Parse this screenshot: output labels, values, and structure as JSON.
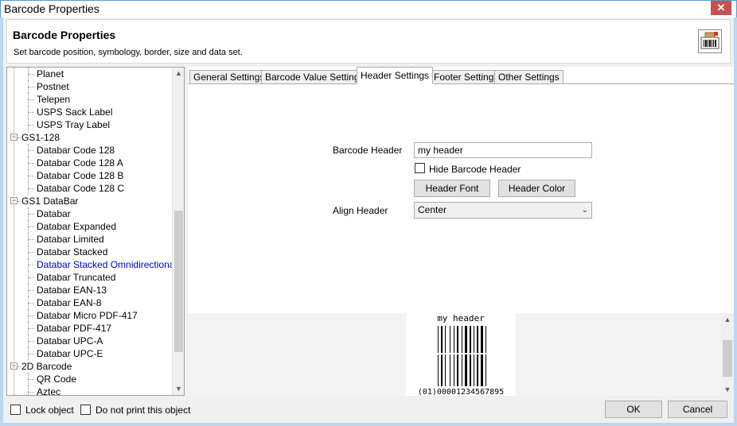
{
  "window": {
    "title": "Barcode Properties",
    "close_glyph": "✕"
  },
  "header": {
    "title": "Barcode Properties",
    "description": "Set barcode position, symbology, border, size and data set.",
    "icon": "barcode-printer-icon"
  },
  "tree": {
    "items": [
      {
        "label": "Planet",
        "level": 1
      },
      {
        "label": "Postnet",
        "level": 1
      },
      {
        "label": "Telepen",
        "level": 1
      },
      {
        "label": "USPS Sack Label",
        "level": 1
      },
      {
        "label": "USPS Tray Label",
        "level": 1
      },
      {
        "label": "GS1-128",
        "level": 0
      },
      {
        "label": "Databar Code 128",
        "level": 1
      },
      {
        "label": "Databar Code 128 A",
        "level": 1
      },
      {
        "label": "Databar Code 128 B",
        "level": 1
      },
      {
        "label": "Databar Code 128 C",
        "level": 1
      },
      {
        "label": "GS1 DataBar",
        "level": 0
      },
      {
        "label": "Databar",
        "level": 1
      },
      {
        "label": "Databar Expanded",
        "level": 1
      },
      {
        "label": "Databar Limited",
        "level": 1
      },
      {
        "label": "Databar Stacked",
        "level": 1
      },
      {
        "label": "Databar Stacked Omnidirectional",
        "level": 1,
        "selected": true
      },
      {
        "label": "Databar Truncated",
        "level": 1
      },
      {
        "label": "Databar EAN-13",
        "level": 1
      },
      {
        "label": "Databar EAN-8",
        "level": 1
      },
      {
        "label": "Databar Micro PDF-417",
        "level": 1
      },
      {
        "label": "Databar PDF-417",
        "level": 1
      },
      {
        "label": "Databar UPC-A",
        "level": 1
      },
      {
        "label": "Databar UPC-E",
        "level": 1
      },
      {
        "label": "2D Barcode",
        "level": 0
      },
      {
        "label": "QR Code",
        "level": 1
      },
      {
        "label": "Aztec",
        "level": 1
      }
    ],
    "collapse_glyph": "−",
    "scroll_up_glyph": "▲",
    "scroll_down_glyph": "▼"
  },
  "tabs": [
    {
      "label": "General Settings"
    },
    {
      "label": "Barcode Value Settings"
    },
    {
      "label": "Header Settings",
      "active": true
    },
    {
      "label": "Footer Settings"
    },
    {
      "label": "Other Settings"
    }
  ],
  "header_settings": {
    "barcode_header_label": "Barcode Header",
    "barcode_header_value": "my header",
    "hide_header_label": "Hide Barcode Header",
    "hide_header_checked": false,
    "header_font_button": "Header Font",
    "header_color_button": "Header Color",
    "align_header_label": "Align Header",
    "align_header_value": "Center",
    "combo_arrow_glyph": "⌄"
  },
  "preview": {
    "header_text": "my header",
    "human_readable": "(01)00001234567895",
    "scroll_up_glyph": "▲",
    "scroll_down_glyph": "▼"
  },
  "footer": {
    "lock_object_label": "Lock object",
    "lock_object_checked": false,
    "no_print_label": "Do not print this object",
    "no_print_checked": false,
    "ok_button": "OK",
    "cancel_button": "Cancel"
  },
  "colors": {
    "selected_tree_item": "#0000cc",
    "close_button": "#c75050",
    "window_border": "#bcd6f0"
  }
}
